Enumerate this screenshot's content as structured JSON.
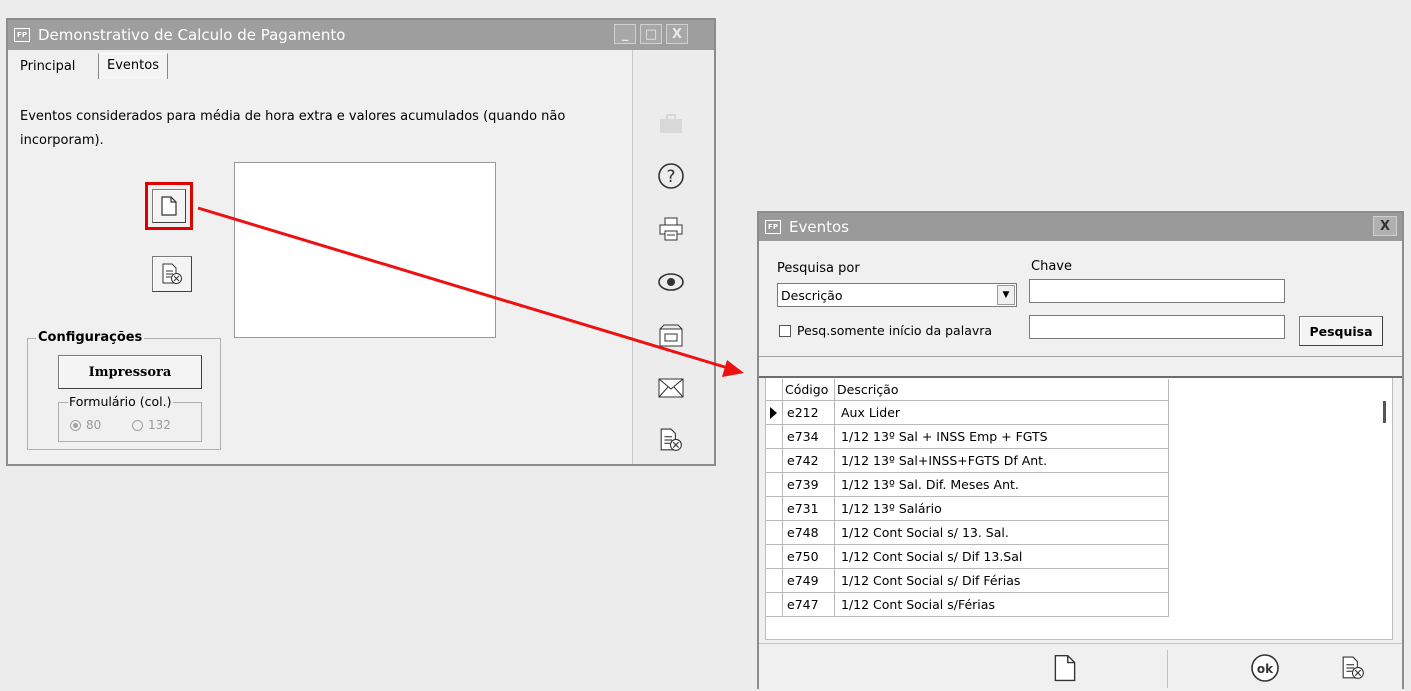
{
  "main_window": {
    "title": "Demonstrativo de Calculo de Pagamento",
    "fp_icon": "FP",
    "title_buttons": [
      "_",
      "□",
      "X"
    ],
    "tabs": [
      {
        "label": "Principal"
      },
      {
        "label": "Eventos"
      }
    ],
    "active_tab": "Eventos",
    "description": "Eventos considerados para média de hora extra e valores acumulados (quando não incorporam).",
    "config_group_label": "Configurações",
    "print_button_label": "Impressora",
    "form_group_label": "Formulário (col.)",
    "radio_80_label": "80",
    "radio_132_label": "132",
    "radio_selected": "80",
    "sidebar_icons": [
      "briefcase-icon",
      "help-icon",
      "printer-icon",
      "preview-icon",
      "disk-icon",
      "mail-icon",
      "close-document-icon"
    ]
  },
  "dialog": {
    "title": "Eventos",
    "fp_icon": "FP",
    "close_label": "X",
    "search_by_label": "Pesquisa por",
    "search_by_value": "Descrição",
    "key_label": "Chave",
    "key_value": "",
    "checkbox_label": "Pesq.somente início da palavra",
    "checkbox_checked": false,
    "second_field_value": "",
    "search_button_label": "Pesquisa",
    "columns": [
      "Código",
      "Descrição"
    ],
    "rows": [
      {
        "code": "e212",
        "desc": " Aux Lider"
      },
      {
        "code": "e734",
        "desc": "1/12 13º Sal + INSS Emp + FGTS"
      },
      {
        "code": "e742",
        "desc": "1/12 13º Sal+INSS+FGTS Df Ant."
      },
      {
        "code": "e739",
        "desc": "1/12 13º Sal. Dif. Meses Ant."
      },
      {
        "code": "e731",
        "desc": "1/12 13º Salário"
      },
      {
        "code": "e748",
        "desc": "1/12 Cont Social s/ 13. Sal."
      },
      {
        "code": "e750",
        "desc": "1/12 Cont Social s/ Dif 13.Sal"
      },
      {
        "code": "e749",
        "desc": "1/12 Cont Social s/ Dif Férias"
      },
      {
        "code": "e747",
        "desc": "1/12 Cont Social s/Férias"
      }
    ],
    "selected_row": 0,
    "footer_icons": [
      "new-document-icon",
      "ok-icon",
      "close-document-icon"
    ]
  },
  "colors": {
    "titlebar": "#9e9e9e",
    "highlight": "#e00000",
    "arrow": "#ee1111"
  }
}
